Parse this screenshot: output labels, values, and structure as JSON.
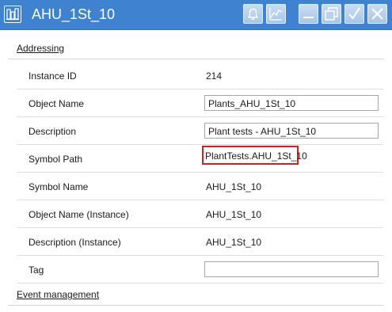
{
  "window": {
    "title": "AHU_1St_10",
    "accent_color": "#3f82cf",
    "icons": {
      "app": "plant-object-icon",
      "alarm": "bell-icon",
      "trend": "trend-chart-icon",
      "minimize": "minimize-icon",
      "restore": "restore-icon",
      "confirm": "checkmark-icon",
      "close": "close-icon"
    }
  },
  "sections": {
    "addressing": "Addressing",
    "event_management": "Event management"
  },
  "properties": [
    {
      "label": "Instance ID",
      "value": "214",
      "kind": "text"
    },
    {
      "label": "Object Name",
      "value": "Plants_AHU_1St_10",
      "kind": "input"
    },
    {
      "label": "Description",
      "value": "Plant tests - AHU_1St_10",
      "kind": "input"
    },
    {
      "label": "Symbol Path",
      "value": "PlantTests.AHU_1St_10",
      "kind": "highlighted"
    },
    {
      "label": "Symbol Name",
      "value": "AHU_1St_10",
      "kind": "text"
    },
    {
      "label": "Object Name (Instance)",
      "value": "AHU_1St_10",
      "kind": "text"
    },
    {
      "label": "Description (Instance)",
      "value": "AHU_1St_10",
      "kind": "text"
    },
    {
      "label": "Tag",
      "value": "",
      "kind": "input"
    }
  ]
}
